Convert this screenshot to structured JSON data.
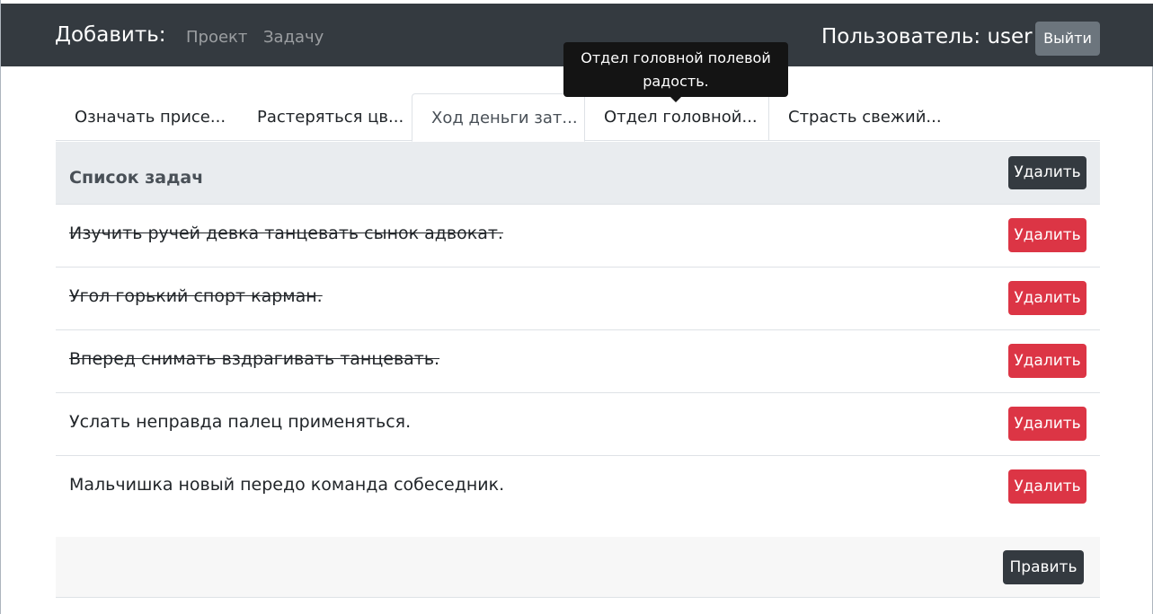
{
  "navbar": {
    "brand": "Добавить:",
    "links": [
      "Проект",
      "Задачу"
    ],
    "user_label": "Пользователь: user",
    "logout_label": "Выйти"
  },
  "tooltip": {
    "text": "Отдел головной полевой радость."
  },
  "tabs": [
    {
      "label": "Означать присе...",
      "active": false
    },
    {
      "label": "Растеряться цв...",
      "active": false
    },
    {
      "label": "Ход деньги зат...",
      "active": true
    },
    {
      "label": "Отдел головной...",
      "active": false
    },
    {
      "label": "Страсть свежий...",
      "active": false
    }
  ],
  "card": {
    "title": "Список задач",
    "header_delete_label": "Удалить",
    "edit_label": "Править"
  },
  "tasks": [
    {
      "text": "Изучить ручей девка танцевать сынок адвокат.",
      "done": true,
      "delete_label": "Удалить"
    },
    {
      "text": "Угол горький спорт карман.",
      "done": true,
      "delete_label": "Удалить"
    },
    {
      "text": "Вперед снимать вздрагивать танцевать.",
      "done": true,
      "delete_label": "Удалить"
    },
    {
      "text": "Услать неправда палец применяться.",
      "done": false,
      "delete_label": "Удалить"
    },
    {
      "text": "Мальчишка новый передо команда собеседник.",
      "done": false,
      "delete_label": "Удалить"
    }
  ],
  "colors": {
    "navbar": "#343a40",
    "danger": "#dc3545",
    "dark_button": "#343a40",
    "secondary_button": "#6c757d",
    "card_header": "#e9ecef",
    "tooltip": "#141414"
  }
}
